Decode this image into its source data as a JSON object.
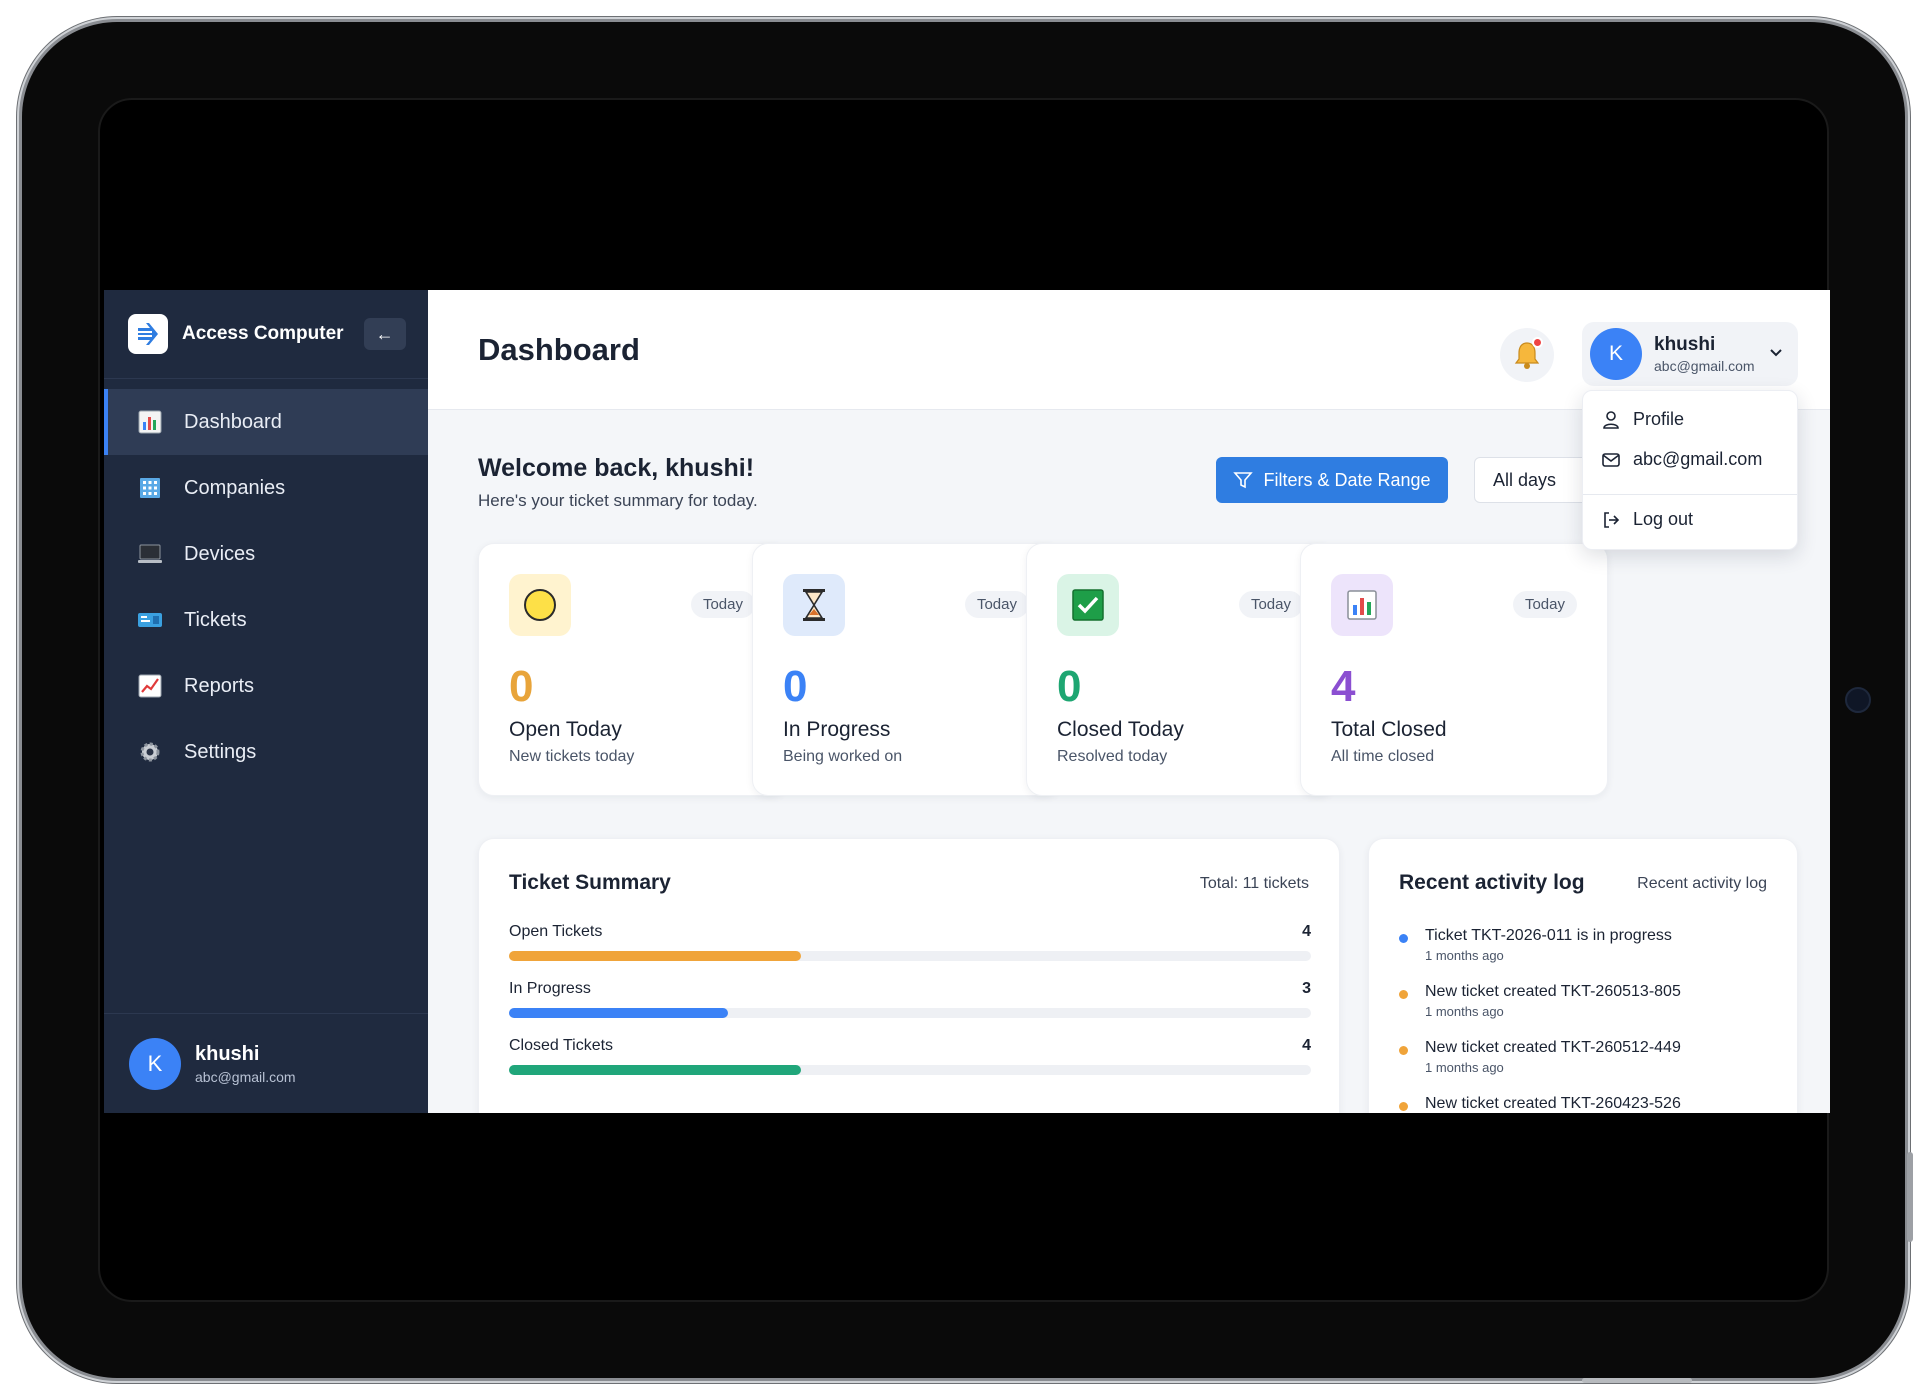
{
  "app": {
    "name": "Access Computer",
    "collapse_icon": "←"
  },
  "sidebar": {
    "items": [
      {
        "label": "Dashboard",
        "icon": "bar-chart-icon",
        "active": true
      },
      {
        "label": "Companies",
        "icon": "building-icon",
        "active": false
      },
      {
        "label": "Devices",
        "icon": "laptop-icon",
        "active": false
      },
      {
        "label": "Tickets",
        "icon": "ticket-icon",
        "active": false
      },
      {
        "label": "Reports",
        "icon": "trend-chart-icon",
        "active": false
      },
      {
        "label": "Settings",
        "icon": "gear-icon",
        "active": false
      }
    ],
    "user": {
      "initial": "K",
      "name": "khushi",
      "email": "abc@gmail.com"
    }
  },
  "header": {
    "title": "Dashboard",
    "user": {
      "initial": "K",
      "name": "khushi",
      "email": "abc@gmail.com"
    }
  },
  "dropdown": {
    "profile": "Profile",
    "email": "abc@gmail.com",
    "logout": "Log out"
  },
  "welcome": {
    "heading": "Welcome back, khushi!",
    "subheading": "Here's your ticket summary for today."
  },
  "filters": {
    "button_label": "Filters & Date Range",
    "range_value": "All days"
  },
  "stats": [
    {
      "value": "0",
      "label": "Open Today",
      "sub": "New tickets today",
      "badge": "Today",
      "color": "#e8a43a",
      "icon": "sun-icon"
    },
    {
      "value": "0",
      "label": "In Progress",
      "sub": "Being worked on",
      "badge": "Today",
      "color": "#3b82f6",
      "icon": "hourglass-icon"
    },
    {
      "value": "0",
      "label": "Closed Today",
      "sub": "Resolved today",
      "badge": "Today",
      "color": "#1ea672",
      "icon": "check-box-icon"
    },
    {
      "value": "4",
      "label": "Total Closed",
      "sub": "All time closed",
      "badge": "Today",
      "color": "#8b4fd1",
      "icon": "bar-chart-icon"
    }
  ],
  "summary": {
    "title": "Ticket Summary",
    "total": "Total: 11 tickets",
    "rows": [
      {
        "label": "Open Tickets",
        "value": "4",
        "fraction": 0.364,
        "color": "#f0a43a"
      },
      {
        "label": "In Progress",
        "value": "3",
        "fraction": 0.273,
        "color": "#3b82f6"
      },
      {
        "label": "Closed Tickets",
        "value": "4",
        "fraction": 0.364,
        "color": "#20a67a"
      }
    ]
  },
  "activity": {
    "title": "Recent activity log",
    "note": "Recent activity log",
    "items": [
      {
        "text": "Ticket TKT-2026-011 is in progress",
        "time": "1 months ago",
        "color": "#3b82f6"
      },
      {
        "text": "New ticket created TKT-260513-805",
        "time": "1 months ago",
        "color": "#f0a43a"
      },
      {
        "text": "New ticket created TKT-260512-449",
        "time": "1 months ago",
        "color": "#f0a43a"
      },
      {
        "text": "New ticket created TKT-260423-526",
        "time": "",
        "color": "#f0a43a"
      }
    ]
  }
}
